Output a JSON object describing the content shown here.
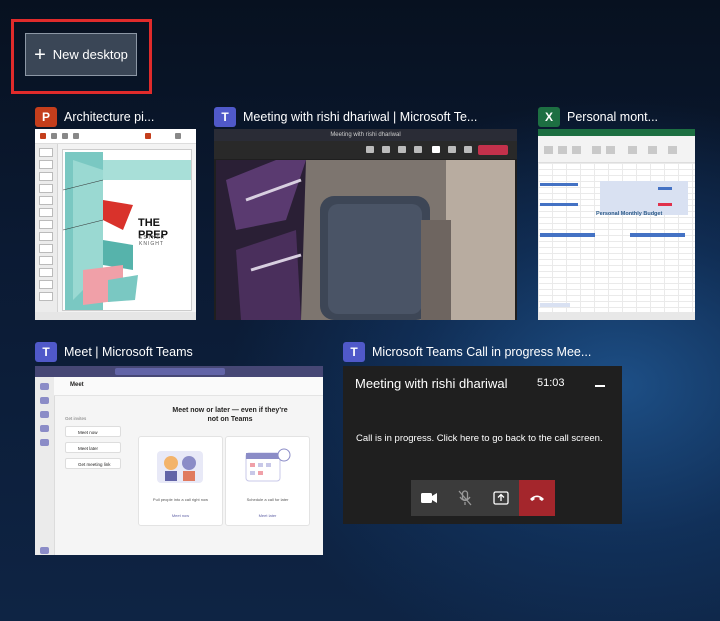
{
  "new_desktop": {
    "label": "New desktop"
  },
  "windows": [
    {
      "app": "PowerPoint",
      "icon": "powerpoint-icon",
      "title": "Architecture pi...",
      "slide_title": "THE PREP",
      "slide_subtitle": "ESTHER KNIGHT"
    },
    {
      "app": "Microsoft Teams",
      "icon": "teams-icon",
      "title": "Meeting with rishi dhariwal | Microsoft Te...",
      "bar_text": "Meeting with rishi dhariwal"
    },
    {
      "app": "Excel",
      "icon": "excel-icon",
      "title": "Personal mont...",
      "sheet_title": "Personal Monthly Budget"
    },
    {
      "app": "Microsoft Teams",
      "icon": "teams-icon",
      "title": "Meet | Microsoft Teams",
      "page": "Meet",
      "share_label": "Get invites",
      "buttons": [
        "Meet now",
        "Meet later",
        "Get meeting link"
      ],
      "heading": "Meet now or later — even if they're not on Teams",
      "card1_text": "Pull people into a call right now",
      "card1_link": "Meet now",
      "card2_text": "Schedule a call for later",
      "card2_link": "Meet later"
    },
    {
      "app": "Microsoft Teams",
      "icon": "teams-icon",
      "title": "Microsoft Teams Call in progress Mee...",
      "call_title": "Meeting with rishi dhariwal",
      "call_time": "51:03",
      "call_message": "Call is in progress. Click here to go back to the call screen."
    }
  ],
  "colors": {
    "highlight": "#e02b2b",
    "teams": "#5059c9",
    "powerpoint": "#c43e1c",
    "excel": "#1d6f42",
    "hangup": "#a4262c"
  }
}
